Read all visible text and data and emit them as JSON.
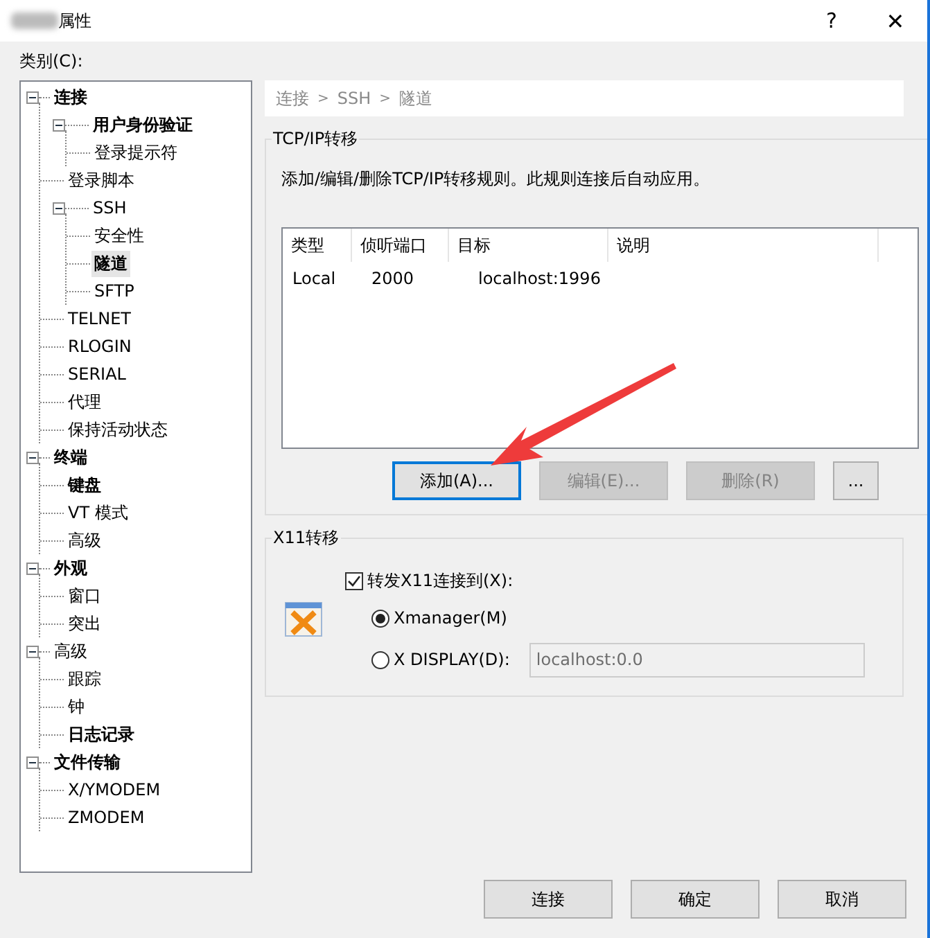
{
  "window": {
    "title": "属性",
    "help": "?",
    "close": "✕"
  },
  "category_label": "类别(C):",
  "tree": [
    {
      "label": "连接",
      "bold": true,
      "selected": false,
      "expanded": true,
      "children": [
        {
          "label": "用户身份验证",
          "bold": true,
          "selected": false,
          "expanded": true,
          "children": [
            {
              "label": "登录提示符",
              "bold": false,
              "selected": false
            }
          ]
        },
        {
          "label": "登录脚本",
          "bold": false,
          "selected": false
        },
        {
          "label": "SSH",
          "bold": false,
          "selected": false,
          "expanded": true,
          "children": [
            {
              "label": "安全性",
              "bold": false,
              "selected": false
            },
            {
              "label": "隧道",
              "bold": true,
              "selected": true
            },
            {
              "label": "SFTP",
              "bold": false,
              "selected": false
            }
          ]
        },
        {
          "label": "TELNET",
          "bold": false,
          "selected": false
        },
        {
          "label": "RLOGIN",
          "bold": false,
          "selected": false
        },
        {
          "label": "SERIAL",
          "bold": false,
          "selected": false
        },
        {
          "label": "代理",
          "bold": false,
          "selected": false
        },
        {
          "label": "保持活动状态",
          "bold": false,
          "selected": false
        }
      ]
    },
    {
      "label": "终端",
      "bold": true,
      "selected": false,
      "expanded": true,
      "children": [
        {
          "label": "键盘",
          "bold": true,
          "selected": false
        },
        {
          "label": "VT 模式",
          "bold": false,
          "selected": false
        },
        {
          "label": "高级",
          "bold": false,
          "selected": false
        }
      ]
    },
    {
      "label": "外观",
      "bold": true,
      "selected": false,
      "expanded": true,
      "children": [
        {
          "label": "窗口",
          "bold": false,
          "selected": false
        },
        {
          "label": "突出",
          "bold": false,
          "selected": false
        }
      ]
    },
    {
      "label": "高级",
      "bold": false,
      "selected": false,
      "expanded": true,
      "children": [
        {
          "label": "跟踪",
          "bold": false,
          "selected": false
        },
        {
          "label": "钟",
          "bold": false,
          "selected": false
        },
        {
          "label": "日志记录",
          "bold": true,
          "selected": false
        }
      ]
    },
    {
      "label": "文件传输",
      "bold": true,
      "selected": false,
      "expanded": true,
      "children": [
        {
          "label": "X/YMODEM",
          "bold": false,
          "selected": false
        },
        {
          "label": "ZMODEM",
          "bold": false,
          "selected": false
        }
      ]
    }
  ],
  "breadcrumb": [
    "连接",
    ">",
    "SSH",
    ">",
    "隧道"
  ],
  "tcp_group": {
    "title": "TCP/IP转移",
    "description": "添加/编辑/删除TCP/IP转移规则。此规则连接后自动应用。",
    "columns": [
      "类型",
      "侦听端口",
      "目标",
      "说明"
    ],
    "rows": [
      [
        "Local",
        "2000",
        "localhost:1996",
        ""
      ]
    ],
    "buttons": [
      {
        "label": "添加(A)...",
        "disabled": false,
        "focused": true
      },
      {
        "label": "编辑(E)...",
        "disabled": true,
        "focused": false
      },
      {
        "label": "删除(R)",
        "disabled": true,
        "focused": false
      },
      {
        "label": "...",
        "disabled": false,
        "focused": false
      }
    ]
  },
  "x11_group": {
    "title": "X11转移",
    "forward": {
      "label": "转发X11连接到(X):",
      "checked": true
    },
    "options": [
      {
        "label": "Xmanager(M)",
        "selected": true
      },
      {
        "label": "X DISPLAY(D):",
        "selected": false
      }
    ],
    "display_value": "localhost:0.0",
    "display_disabled": true
  },
  "footer_buttons": [
    "连接",
    "确定",
    "取消"
  ]
}
